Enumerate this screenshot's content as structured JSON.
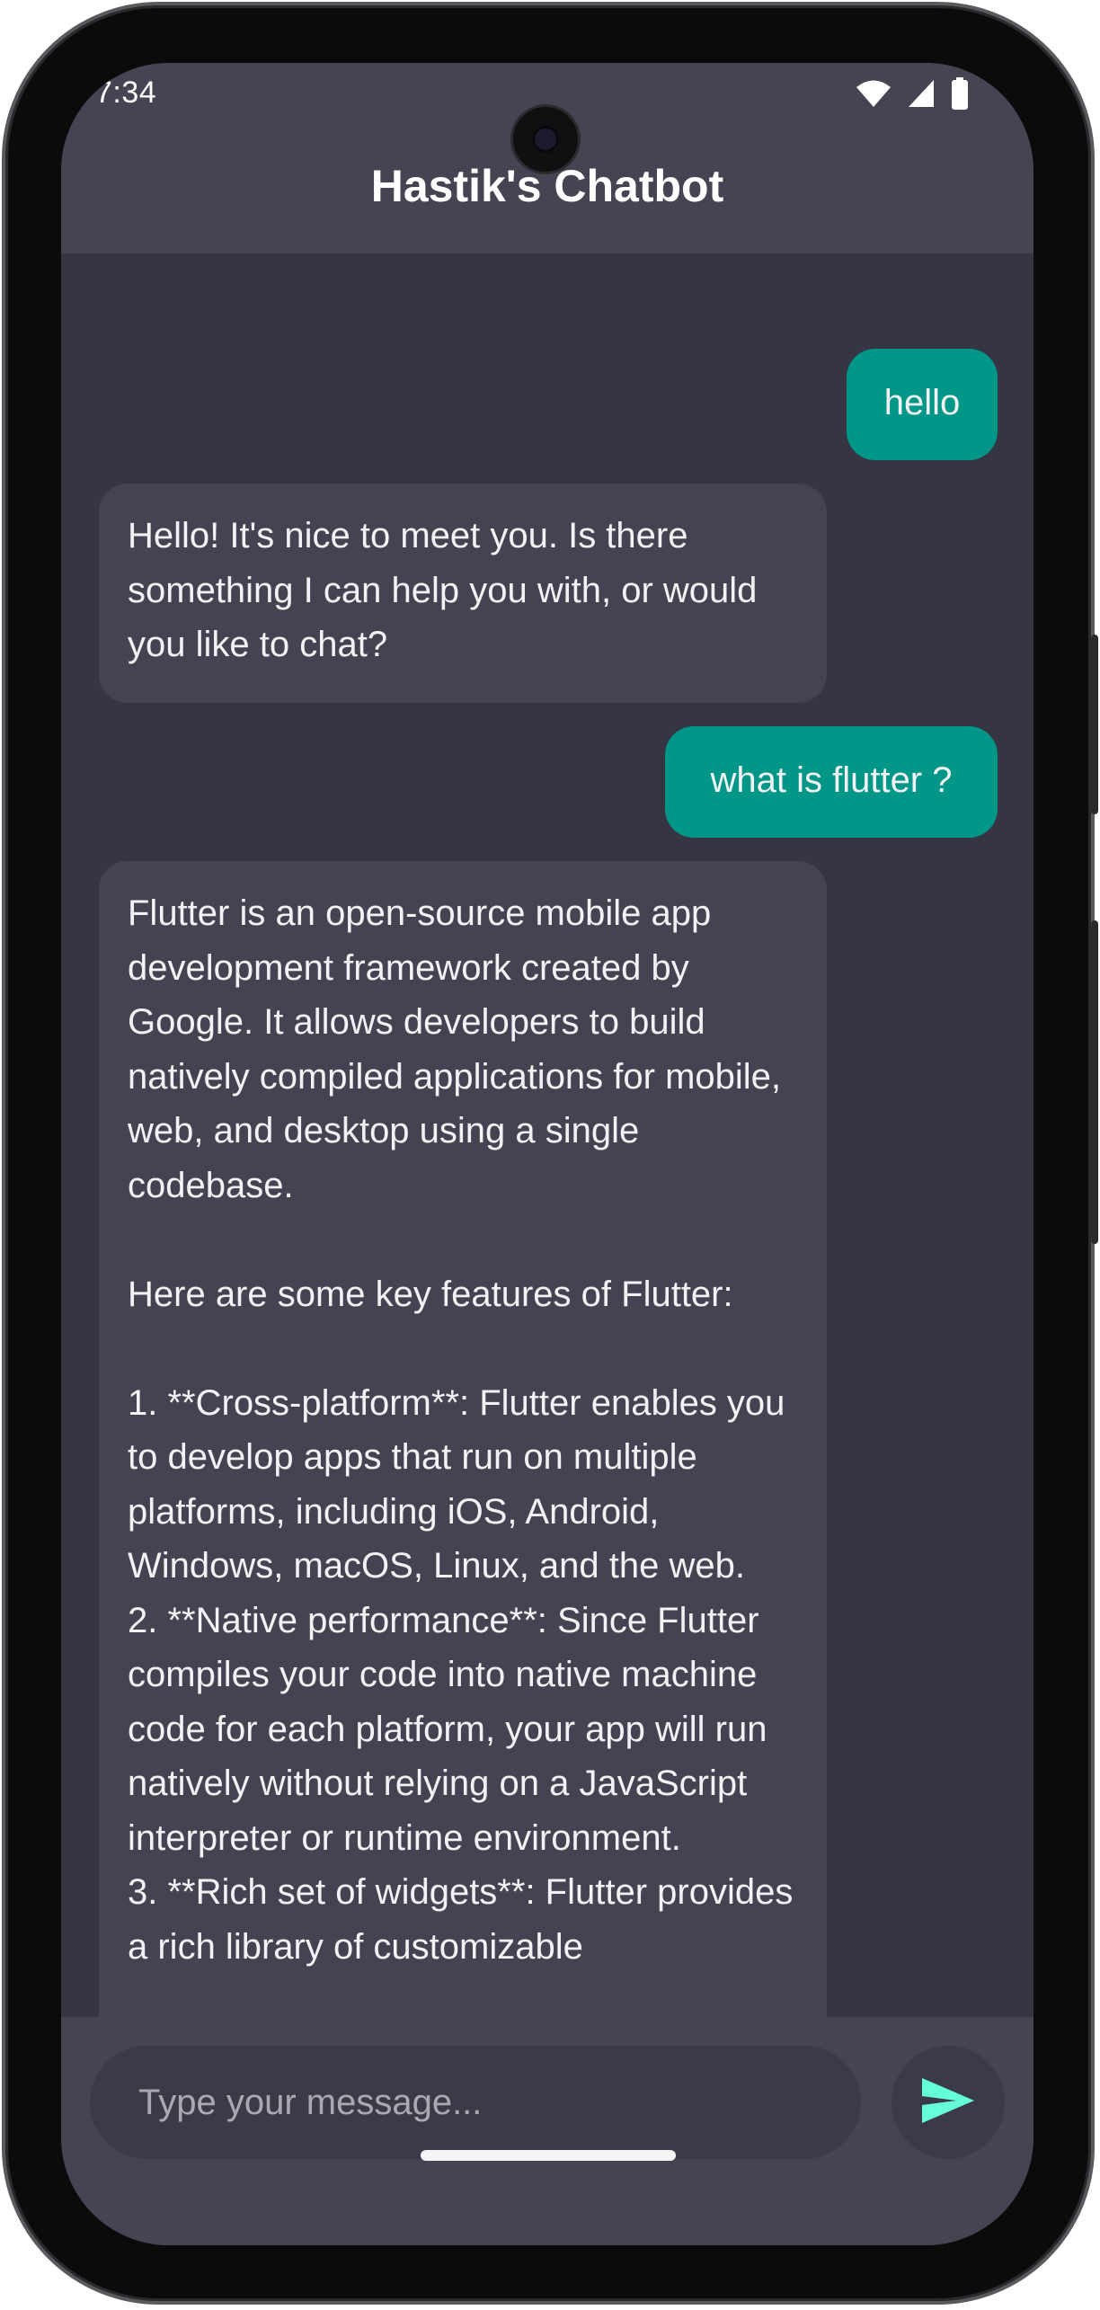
{
  "status_bar": {
    "time": "7:34",
    "icons": [
      "wifi-icon",
      "signal-icon",
      "battery-icon"
    ]
  },
  "app_bar": {
    "title": "Hastik's Chatbot"
  },
  "messages": [
    {
      "role": "user",
      "text": "hello"
    },
    {
      "role": "bot",
      "text": "Hello! It's nice to meet you. Is there something I can help you with, or would you like to chat?"
    },
    {
      "role": "user",
      "text": "what is flutter ?"
    },
    {
      "role": "bot",
      "text": "Flutter is an open-source mobile app development framework created by Google. It allows developers to build natively compiled applications for mobile, web, and desktop using a single codebase.\n\nHere are some key features of Flutter:\n\n1. **Cross-platform**: Flutter enables you to develop apps that run on multiple platforms, including iOS, Android, Windows, macOS, Linux, and the web.\n2. **Native performance**: Since Flutter compiles your code into native machine code for each platform, your app will run natively without relying on a JavaScript interpreter or runtime environment.\n3. **Rich set of widgets**: Flutter provides a rich library of customizable"
    }
  ],
  "input": {
    "placeholder": "Type your message...",
    "send_icon": "send-icon"
  },
  "colors": {
    "screen_bg": "#363543",
    "appbar_bg": "#444452",
    "user_bubble": "#009688",
    "bot_bubble": "#434352",
    "send_accent": "#64FFDA"
  }
}
